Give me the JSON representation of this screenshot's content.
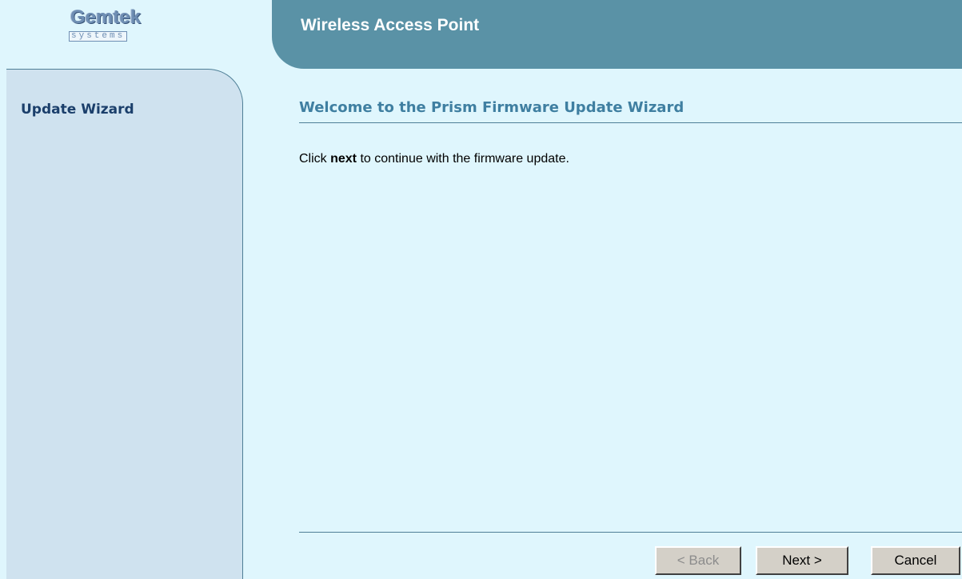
{
  "logo": {
    "brand": "Gemtek",
    "tagline": "systems"
  },
  "header": {
    "title": "Wireless Access Point"
  },
  "sidebar": {
    "items": [
      {
        "label": "Update Wizard"
      }
    ]
  },
  "main": {
    "heading": "Welcome to the Prism Firmware Update Wizard",
    "instruction_prefix": "Click ",
    "instruction_bold": "next",
    "instruction_suffix": " to continue with the firmware update."
  },
  "buttons": {
    "back_label": "< Back",
    "next_label": "Next >",
    "cancel_label": "Cancel"
  },
  "colors": {
    "background": "#dff6fd",
    "header": "#5a92a6",
    "sidebar": "#cfe2ef",
    "heading_text": "#3f7fa1",
    "sidebar_text": "#1b3f6b"
  }
}
